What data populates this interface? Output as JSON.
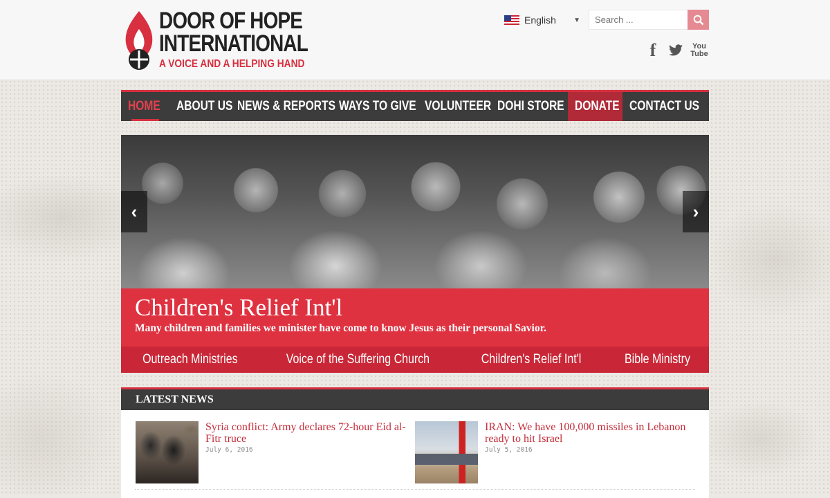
{
  "header": {
    "logo": {
      "title_line1": "DOOR OF HOPE",
      "title_line2": "INTERNATIONAL",
      "tagline": "A VOICE AND A HELPING HAND"
    },
    "language": {
      "selected": "English",
      "flag_icon": "us-flag-icon"
    },
    "search": {
      "placeholder": "Search ..."
    },
    "social": {
      "facebook": "f",
      "youtube_top": "You",
      "youtube_bottom": "Tube"
    }
  },
  "nav": {
    "items": [
      {
        "label": "HOME"
      },
      {
        "label": "ABOUT US"
      },
      {
        "label": "NEWS & REPORTS"
      },
      {
        "label": "WAYS TO GIVE"
      },
      {
        "label": "VOLUNTEER"
      },
      {
        "label": "DOHI STORE"
      },
      {
        "label": "DONATE"
      },
      {
        "label": "CONTACT US"
      }
    ],
    "active_index": 0
  },
  "slider": {
    "prev_label": "‹",
    "next_label": "›",
    "caption_title": "Children's Relief Int'l",
    "caption_text": "Many children and families we minister have come to know Jesus as their personal Savior.",
    "tabs": [
      {
        "label": "Outreach Ministries"
      },
      {
        "label": "Voice of the Suffering Church"
      },
      {
        "label": "Children's Relief Int'l"
      },
      {
        "label": "Bible Ministry"
      }
    ]
  },
  "latest_news": {
    "heading": "LATEST NEWS",
    "items": [
      {
        "title": "Syria conflict: Army declares 72-hour Eid al-Fitr truce",
        "date": "July 6, 2016"
      },
      {
        "title": "IRAN: We have 100,000 missiles in Lebanon ready to hit Israel",
        "date": "July 5, 2016"
      }
    ]
  },
  "colors": {
    "accent": "#d83040",
    "nav_bg": "#3c3c3c",
    "donate_bg": "#b02a37",
    "caption_bg": "#df3241"
  }
}
